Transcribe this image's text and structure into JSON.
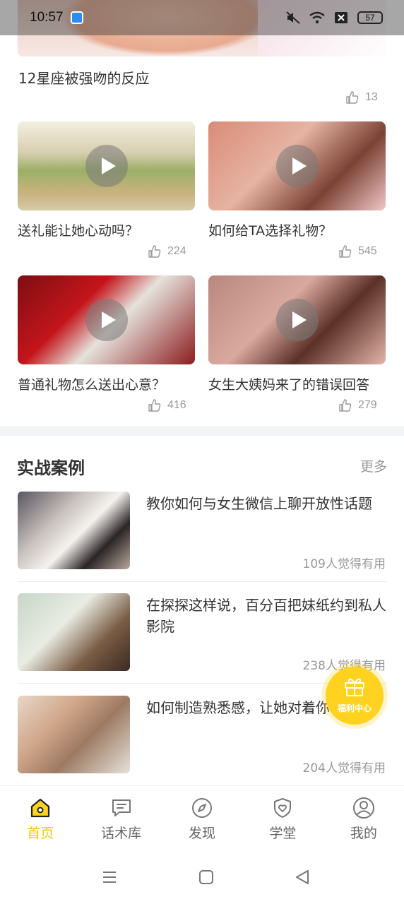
{
  "status_bar": {
    "time": "10:57",
    "battery": "57"
  },
  "featured": {
    "title": "12星座被强吻的反应",
    "likes": "13"
  },
  "videos": [
    {
      "title": "送礼能让她心动吗？",
      "likes": "224"
    },
    {
      "title": "如何给TA选择礼物？",
      "likes": "545"
    },
    {
      "title": "普通礼物怎么送出心意？",
      "likes": "416"
    },
    {
      "title": "女生大姨妈来了的错误回答",
      "likes": "279"
    }
  ],
  "section": {
    "title": "实战案例",
    "more": "更多"
  },
  "cases": [
    {
      "title": "教你如何与女生微信上聊开放性话题",
      "useful": "109人觉得有用"
    },
    {
      "title": "在探探这样说，百分百把妹纸约到私人影院",
      "useful": "238人觉得有用"
    },
    {
      "title": "如何制造熟悉感，让她对着你叫哥哥",
      "useful": "204人觉得有用"
    }
  ],
  "welfare": {
    "label": "福利中心"
  },
  "tabs": [
    {
      "label": "首页",
      "icon": "home-icon",
      "active": true
    },
    {
      "label": "话术库",
      "icon": "chat-icon",
      "active": false
    },
    {
      "label": "发现",
      "icon": "compass-icon",
      "active": false
    },
    {
      "label": "学堂",
      "icon": "shield-icon",
      "active": false
    },
    {
      "label": "我的",
      "icon": "profile-icon",
      "active": false
    }
  ],
  "colors": {
    "accent": "#f5c400",
    "welfare": "#ffd21f",
    "muted": "#999999"
  }
}
